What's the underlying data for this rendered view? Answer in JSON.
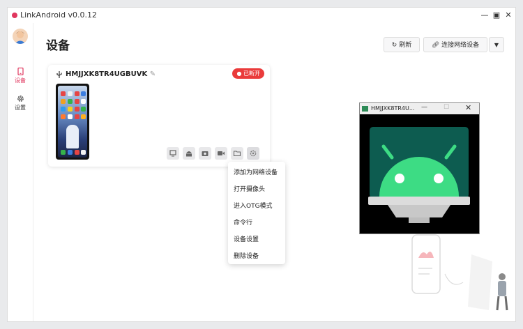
{
  "window": {
    "title": "LinkAndroid v0.0.12"
  },
  "sidebar": {
    "items": [
      {
        "label": "设备",
        "icon": "phone-icon",
        "active": true
      },
      {
        "label": "设置",
        "icon": "gear-icon",
        "active": false
      }
    ]
  },
  "page": {
    "title": "设备"
  },
  "toolbar": {
    "refresh_label": "刷新",
    "connect_label": "连接网络设备"
  },
  "device": {
    "name": "HMJJXK8TR4UGBUVK",
    "status": "已断开",
    "status_color": "#ea3b3b"
  },
  "context_menu": {
    "items": [
      "添加为网络设备",
      "打开摄像头",
      "进入OTG模式",
      "命令行",
      "设备设置",
      "删除设备"
    ]
  },
  "mirror_window": {
    "title": "HMJJXK8TR4U..."
  },
  "colors": {
    "accent": "#e0365e",
    "android_green": "#3ddc84"
  }
}
